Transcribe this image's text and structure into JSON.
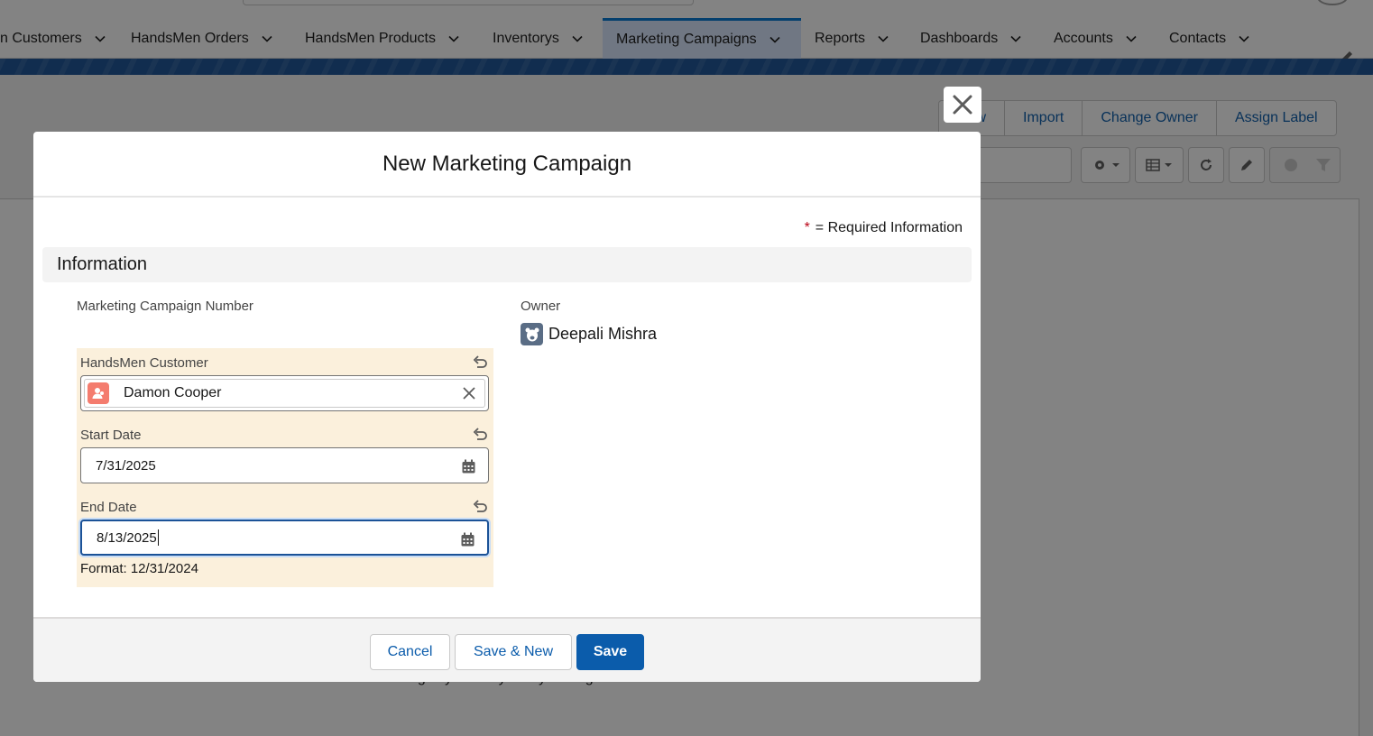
{
  "nav": {
    "tabs": [
      {
        "label": "n Customers"
      },
      {
        "label": "HandsMen Orders"
      },
      {
        "label": "HandsMen Products"
      },
      {
        "label": "Inventorys"
      },
      {
        "label": "Marketing Campaigns",
        "active": true
      },
      {
        "label": "Reports"
      },
      {
        "label": "Dashboards"
      },
      {
        "label": "Accounts"
      },
      {
        "label": "Contacts"
      }
    ]
  },
  "list_view": {
    "actions": [
      "New",
      "Import",
      "Change Owner",
      "Assign Label"
    ],
    "empty_message": "There's nothing in your list yet. Try adding a new record."
  },
  "modal": {
    "title": "New Marketing Campaign",
    "required_star": "*",
    "required_text": "= Required Information",
    "section_title": "Information",
    "fields": {
      "campaign_number_label": "Marketing Campaign Number",
      "owner_label": "Owner",
      "owner_name": "Deepali Mishra",
      "customer_label": "HandsMen Customer",
      "customer_value": "Damon Cooper",
      "start_date_label": "Start Date",
      "start_date_value": "7/31/2025",
      "end_date_label": "End Date",
      "end_date_value": "8/13/2025",
      "date_format_help": "Format: 12/31/2024"
    },
    "footer": {
      "cancel": "Cancel",
      "save_new": "Save & New",
      "save": "Save"
    }
  },
  "colors": {
    "brand": "#0b5cab",
    "banner": "#1b5297",
    "edited_highlight": "#fbf0dc",
    "contact_icon": "#f47c6e",
    "required": "#ba0517"
  }
}
